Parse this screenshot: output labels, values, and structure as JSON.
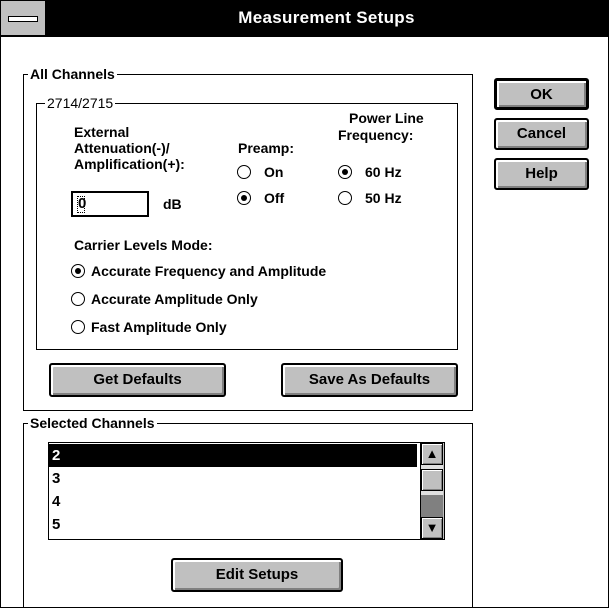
{
  "window": {
    "title": "Measurement Setups"
  },
  "buttons": {
    "ok": "OK",
    "cancel": "Cancel",
    "help": "Help"
  },
  "all_channels": {
    "label": "All Channels",
    "device_group": {
      "label": "2714/2715",
      "ext_att_line1": "External",
      "ext_att_line2": "Attenuation(-)/",
      "ext_att_line3": "Amplification(+):",
      "att_value": "0",
      "att_unit": "dB",
      "preamp_label": "Preamp:",
      "preamp_on": "On",
      "preamp_off": "Off",
      "preamp_selected": "Off",
      "power_line_label1": "Power Line",
      "power_line_label2": "Frequency:",
      "freq_60": "60 Hz",
      "freq_50": "50 Hz",
      "freq_selected": "60 Hz",
      "carrier_label": "Carrier Levels Mode:",
      "carrier_options": [
        "Accurate Frequency and Amplitude",
        "Accurate Amplitude Only",
        "Fast Amplitude Only"
      ],
      "carrier_selected": "Accurate Frequency and Amplitude"
    },
    "get_defaults": "Get Defaults",
    "save_defaults": "Save As Defaults"
  },
  "selected_channels": {
    "label": "Selected Channels",
    "items": [
      "2",
      "3",
      "4",
      "5"
    ],
    "selected_index": 0,
    "up_arrow": "▲",
    "down_arrow": "▼",
    "edit_setups": "Edit Setups"
  },
  "icons": {
    "system_menu": "system-menu-icon",
    "radio_selected": "radio-selected-icon",
    "radio_unselected": "radio-unselected-icon",
    "scroll_up": "scroll-up-icon",
    "scroll_down": "scroll-down-icon"
  },
  "colors": {
    "title_bar": "#000000",
    "button_face": "#c0c0c0",
    "selection": "#000000",
    "background": "#ffffff"
  }
}
